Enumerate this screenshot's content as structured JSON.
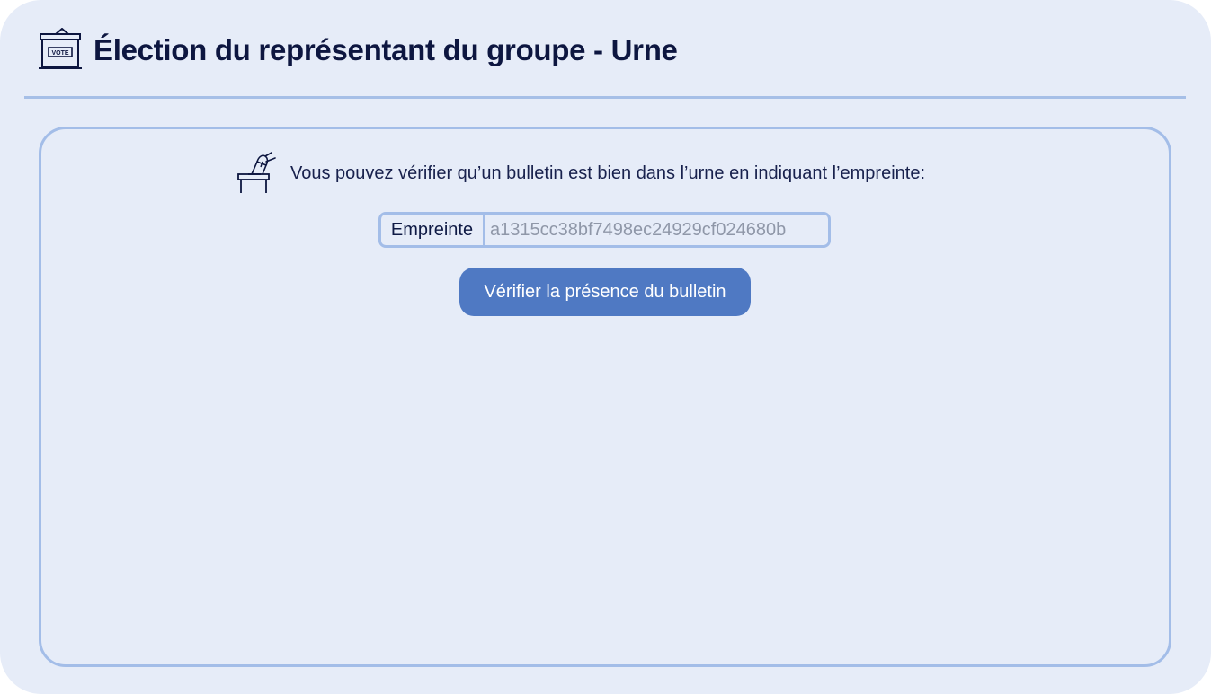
{
  "header": {
    "title": "Élection du représentant du groupe - Urne",
    "icon": "ballot-box-icon",
    "icon_label": "VOTE"
  },
  "verification": {
    "icon": "hand-voting-icon",
    "instructions": "Vous pouvez vérifier qu’un bulletin est bien dans l’urne en indiquant l’empreinte:",
    "fingerprint_label": "Empreinte",
    "fingerprint_placeholder": "a1315cc38bf7498ec24929cf024680b",
    "fingerprint_value": "",
    "verify_button_label": "Vérifier la présence du bulletin"
  },
  "colors": {
    "background": "#e6ecf8",
    "border": "#a3bde8",
    "title": "#0d1640",
    "button": "#4f79c3",
    "button_text": "#ffffff"
  }
}
